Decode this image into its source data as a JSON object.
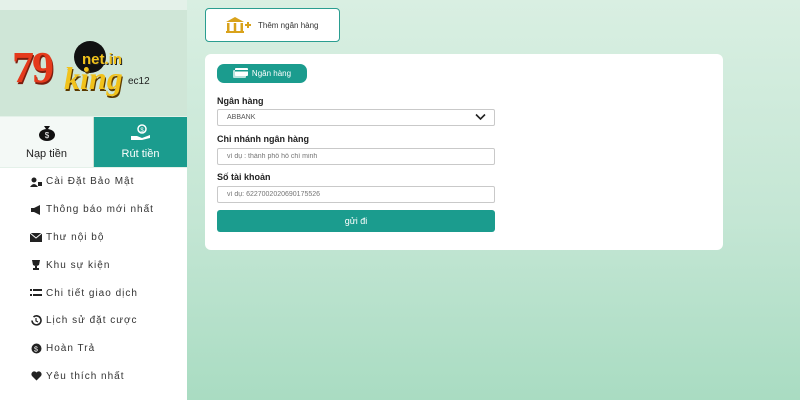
{
  "logo": {
    "brand_main": "79",
    "brand_script": "king",
    "domain": "net.in",
    "username": "ec12"
  },
  "tabs": [
    {
      "label": "Nạp tiền",
      "icon": "money-bag-icon"
    },
    {
      "label": "Rút tiền",
      "icon": "hand-money-icon"
    }
  ],
  "menu": [
    {
      "label": "Cài Đặt Bảo Mật",
      "icon": "user-lock-icon"
    },
    {
      "label": "Thông báo mới nhất",
      "icon": "megaphone-icon"
    },
    {
      "label": "Thư nội bộ",
      "icon": "envelope-icon"
    },
    {
      "label": "Khu sự kiện",
      "icon": "trophy-icon"
    },
    {
      "label": "Chi tiết giao dịch",
      "icon": "list-icon"
    },
    {
      "label": "Lịch sử đặt cược",
      "icon": "history-icon"
    },
    {
      "label": "Hoàn Trả",
      "icon": "coin-icon"
    },
    {
      "label": "Yêu thích nhất",
      "icon": "heart-icon"
    }
  ],
  "add_bank": {
    "label": "Thêm ngân hàng",
    "icon": "bank-add-icon"
  },
  "form": {
    "pill_label": "Ngân hàng",
    "bank_label": "Ngân hàng",
    "bank_value": "ABBANK",
    "branch_label": "Chi nhánh ngân hàng",
    "branch_placeholder": "ví dụ : thành phố hồ chí minh",
    "account_label": "Số tài khoản",
    "account_placeholder": "ví dụ: 6227002020690175526",
    "submit_label": "gửi đi"
  },
  "colors": {
    "accent": "#1b9c8e",
    "logo_red": "#e53a1c",
    "logo_gold": "#f1c21b"
  }
}
